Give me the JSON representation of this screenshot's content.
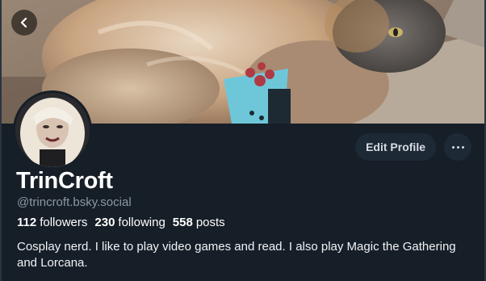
{
  "header": {
    "back_icon": "chevron-left-icon"
  },
  "profile": {
    "display_name": "TrinCroft",
    "handle": "@trincroft.bsky.social",
    "followers_count": "112",
    "followers_label": "followers",
    "following_count": "230",
    "following_label": "following",
    "posts_count": "558",
    "posts_label": "posts",
    "bio": "Cosplay nerd. I like to play video games and read. I also play Magic the Gathering and Lorcana."
  },
  "actions": {
    "edit_label": "Edit Profile",
    "more_icon": "ellipsis-icon"
  },
  "colors": {
    "background": "#161e27",
    "button_bg": "#1e2936",
    "handle_text": "#8b98a6",
    "text": "#ffffff"
  }
}
